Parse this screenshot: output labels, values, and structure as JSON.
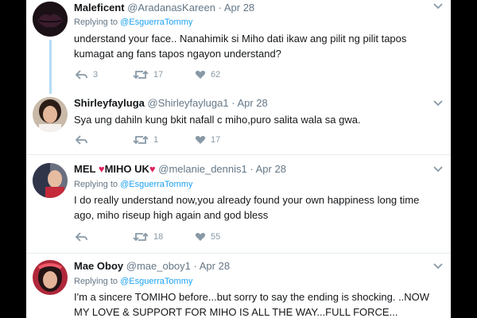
{
  "colors": {
    "accent": "#1da1f2",
    "text": "#14171a",
    "muted": "#657786",
    "heart": "#e0245e"
  },
  "tweets": [
    {
      "name": "Maleficent",
      "handle": "@AradanasKareen",
      "sep": "·",
      "date": "Apr 28",
      "reply_prefix": "Replying to",
      "reply_to": "@EsguerraTommy",
      "text": "understand your face.. Nanahimik si Miho dati ikaw ang pilit ng pilit tapos kumagat ang fans tapos ngayon understand?",
      "reply_count": "3",
      "retweet_count": "17",
      "like_count": "62"
    },
    {
      "name": "Shirleyfayluga",
      "handle": "@Shirleyfayluga1",
      "sep": "·",
      "date": "Apr 28",
      "text": "Sya ung dahiln kung bkit nafall c miho,puro salita wala sa gwa.",
      "reply_count": "",
      "retweet_count": "1",
      "like_count": "17"
    },
    {
      "name_part1": "MEL",
      "name_part2": "MIHO UK",
      "heart_glyph": "♥",
      "handle": "@melanie_dennis1",
      "sep": "·",
      "date": "Apr 28",
      "reply_prefix": "Replying to",
      "reply_to": "@EsguerraTommy",
      "text": "I do really understand now,you already found your own happiness long time ago, miho riseup high again and god bless",
      "reply_count": "",
      "retweet_count": "18",
      "like_count": "55"
    },
    {
      "name": "Mae Oboy",
      "handle": "@mae_oboy1",
      "sep": "·",
      "date": "Apr 28",
      "reply_prefix": "Replying to",
      "reply_to": "@EsguerraTommy",
      "text": "I'm a sincere TOMIHO before...but sorry to say the ending is shocking. ..NOW MY LOVE & SUPPORT FOR MIHO IS ALL THE WAY...FULL FORCE..."
    }
  ],
  "icons": [
    "reply-icon",
    "retweet-icon",
    "like-icon",
    "caret-down-icon"
  ]
}
